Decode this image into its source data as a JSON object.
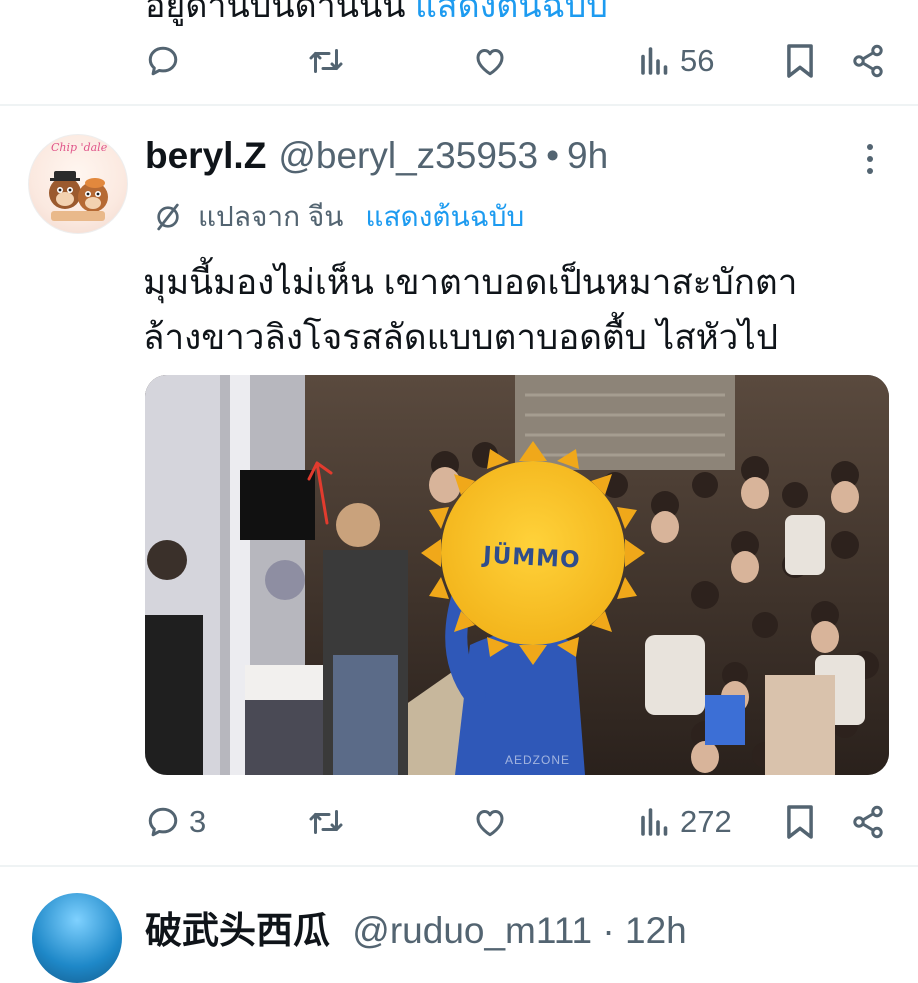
{
  "top_tweet": {
    "text": "อยู่ด้านบนด้านนั้น",
    "link": "แสดงต้นฉบับ",
    "actions": {
      "reply_count": "",
      "retweet_count": "",
      "like_count": "",
      "views_count": "56"
    }
  },
  "tweet": {
    "display_name": "beryl.Z",
    "handle": "@beryl_z35953",
    "separator": "•",
    "time": "9h",
    "avatar_label": "Chip 'dale",
    "translation": {
      "label": "แปลจาก จีน",
      "show_original": "แสดงต้นฉบับ"
    },
    "text_line1": "มุมนี้มองไม่เห็น เขาตาบอดเป็นหมาสะบักตา",
    "text_line2": "ล้างขาวลิงโจรสลัดแบบตาบอดตื้บ ไสหัวไป",
    "media": {
      "mascot_text": "JÜMMO",
      "watermark": "AEDZONE"
    },
    "actions": {
      "reply_count": "3",
      "retweet_count": "",
      "like_count": "",
      "views_count": "272"
    }
  },
  "next_tweet": {
    "display_name": "破武头西瓜",
    "handle": "@ruduo_m111 · 12h"
  },
  "colors": {
    "accent": "#1d9bf0",
    "secondary_text": "#536471",
    "divider": "#eff3f4"
  },
  "icons": [
    "reply-icon",
    "retweet-icon",
    "like-icon",
    "views-icon",
    "bookmark-icon",
    "share-icon",
    "more-icon",
    "translate-icon"
  ]
}
